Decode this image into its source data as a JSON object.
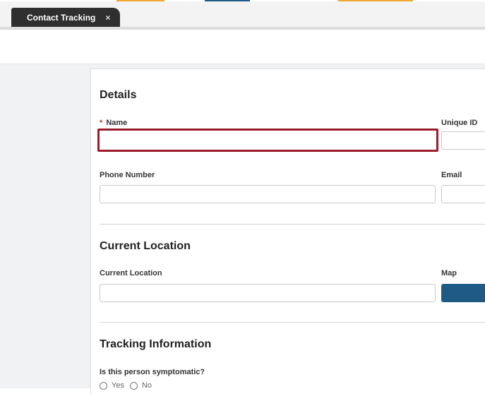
{
  "colors": {
    "accent_orange": "#f0a830",
    "accent_blue": "#1f5a84",
    "highlight_border": "#9b1b2b",
    "required_marker": "#c0392b",
    "tab_bg": "#2f2f2f"
  },
  "tab": {
    "label": "Contact Tracking",
    "close_icon": "×"
  },
  "sections": {
    "details": "Details",
    "current_location": "Current Location",
    "tracking_information": "Tracking Information"
  },
  "fields": {
    "name_label": "Name",
    "name_required_marker": "*",
    "name_value": "",
    "unique_id_label": "Unique ID",
    "phone_label": "Phone Number",
    "email_label": "Email",
    "current_location_label": "Current Location",
    "map_label": "Map",
    "symptomatic_label": "Is this person symptomatic?",
    "symptomatic_options": {
      "yes": "Yes",
      "no": "No"
    }
  }
}
